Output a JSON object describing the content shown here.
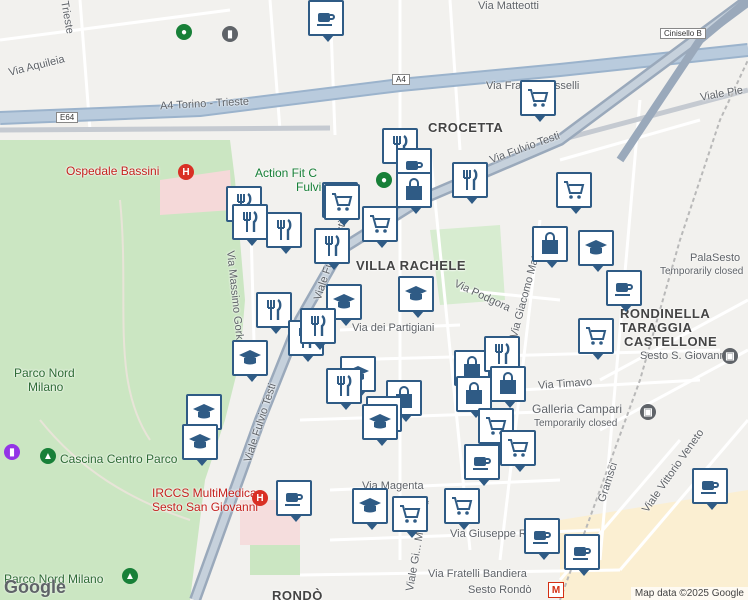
{
  "map": {
    "highway_shield_label": "E64",
    "highway_shield_a4": "A4",
    "shield_cinisello": "Cinisello B",
    "attribution": "Map data ©2025 Google",
    "google_logo": "Google"
  },
  "labels": {
    "trieste": "Trieste",
    "via_aquileia": "Via Aquileia",
    "a4_torino_trieste": "A4 Torino - Trieste",
    "via_matteotti": "Via Matteotti",
    "via_fratelli_rosselli": "Via Fratelli Rosselli",
    "viale_pie": "Viale Pie",
    "crocetta": "CROCETTA",
    "via_fulvio_testi": "Via Fulvio Testi",
    "ospedale_bassini": "Ospedale Bassini",
    "action_fit": "Action Fit C",
    "action_fit_2": "Fulvio",
    "villa_rachele": "VILLA RACHELE",
    "via_massimo_gorki": "Via Massimo Gorki",
    "viale_fulvio_testi_a": "Viale Fulvio Testi",
    "via_podgora": "Via Podgora",
    "via_dei_partigiani": "Via dei Partigiani",
    "via_giacomo_matteotti": "Via Giacomo Matteotti",
    "palasesto": "PalaSesto",
    "palasesto_status": "Temporarily closed",
    "rondinella": "RONDINELLA",
    "taraggia": "TARAGGIA",
    "castellone": "CASTELLONE",
    "sesto_san_giovanni": "Sesto S. Giovanni",
    "parco_nord_milano": "Parco Nord\nMilano",
    "parco_nord_milano_1": "Parco Nord",
    "parco_nord_milano_2": "Milano",
    "via_timavo": "Via Timavo",
    "galleria_campari": "Galleria Campari",
    "galleria_campari_status": "Temporarily closed",
    "viale_fulvio_testi_b": "Viale Fulvio Testi",
    "cascina_centro_parco": "Cascina Centro Parco",
    "via_magenta": "Via Magenta",
    "irccs_1": "IRCCS MultiMedica",
    "irccs_2": "Sesto San Giovanni",
    "viale_gramsci": "Gramsci",
    "viale_vittorio_veneto": "Viale Vittorio Veneto",
    "via_giuseppe_ro": "Via Giuseppe Ro",
    "via_fratelli_bandiera": "Via Fratelli Bandiera",
    "parco_nord_milano_bottom": "Parco Nord Milano",
    "rondo": "RONDÒ",
    "sesto_rondo": "Sesto Rondò",
    "viale_gi_matteotti": "Viale Gi... Matteotti"
  },
  "markers": [
    {
      "type": "coffee"
    },
    {
      "type": "cart"
    },
    {
      "type": "fork"
    },
    {
      "type": "coffee"
    },
    {
      "type": "bag"
    },
    {
      "type": "fork"
    },
    {
      "type": "cart"
    },
    {
      "type": "cart"
    },
    {
      "type": "fork"
    },
    {
      "type": "fork"
    },
    {
      "type": "cart"
    },
    {
      "type": "fork"
    },
    {
      "type": "bag"
    },
    {
      "type": "school"
    },
    {
      "type": "cart"
    },
    {
      "type": "fork"
    },
    {
      "type": "school"
    },
    {
      "type": "school"
    },
    {
      "type": "coffee"
    },
    {
      "type": "fork"
    },
    {
      "type": "cart"
    },
    {
      "type": "school"
    },
    {
      "type": "fork"
    },
    {
      "type": "school"
    },
    {
      "type": "bag"
    },
    {
      "type": "fork"
    },
    {
      "type": "bag"
    },
    {
      "type": "bag"
    },
    {
      "type": "bag"
    },
    {
      "type": "cart"
    },
    {
      "type": "coffee"
    },
    {
      "type": "cart"
    },
    {
      "type": "school"
    },
    {
      "type": "school"
    },
    {
      "type": "coffee"
    },
    {
      "type": "school"
    },
    {
      "type": "cart"
    },
    {
      "type": "cart"
    },
    {
      "type": "coffee"
    },
    {
      "type": "coffee"
    },
    {
      "type": "coffee"
    },
    {
      "type": "school"
    },
    {
      "type": "fork"
    },
    {
      "type": "fork"
    },
    {
      "type": "school"
    }
  ]
}
